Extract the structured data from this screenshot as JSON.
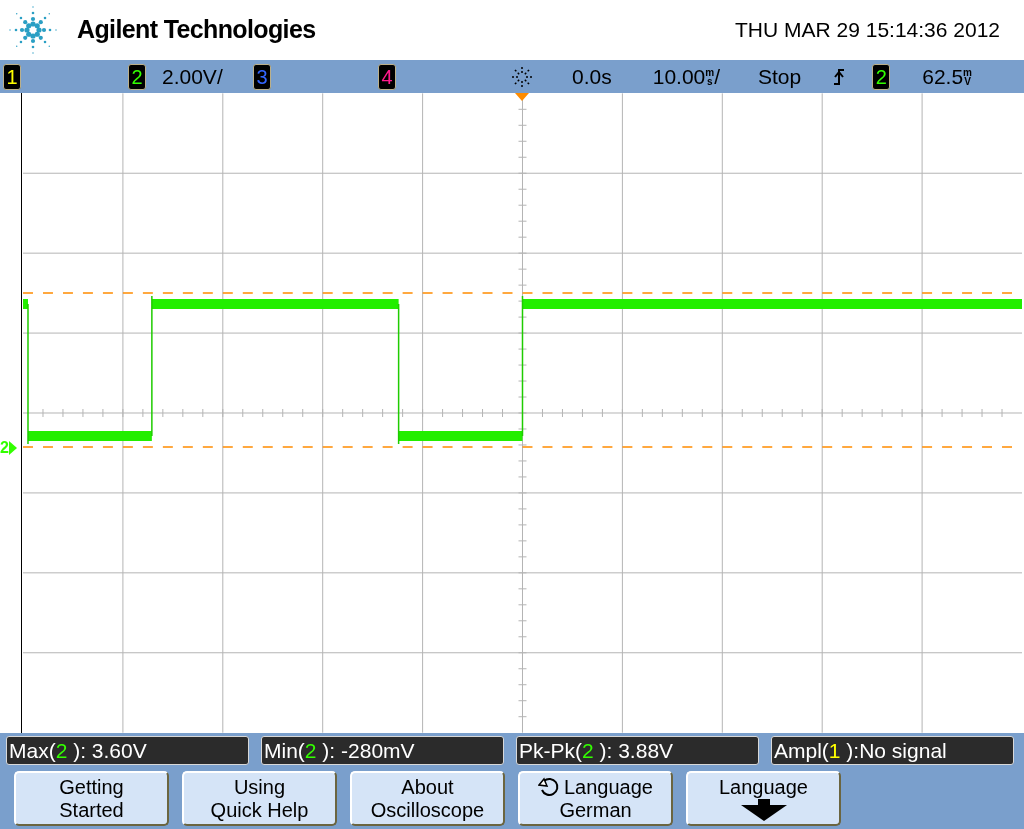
{
  "header": {
    "brand": "Agilent Technologies",
    "datetime": "THU MAR 29 15:14:36 2012"
  },
  "status_bar": {
    "channels": [
      {
        "label": "1",
        "color": "#ffff00"
      },
      {
        "label": "2",
        "color": "#33ff00",
        "scale": "2.00V/"
      },
      {
        "label": "3",
        "color": "#3366ff"
      },
      {
        "label": "4",
        "color": "#ff1a8c"
      }
    ],
    "delay": "0.0s",
    "timebase": {
      "value": "10.00",
      "unit_top": "m",
      "unit_bottom": "s",
      "suffix": "/"
    },
    "run_state": "Stop",
    "trigger_channel": {
      "label": "2",
      "color": "#33ff00"
    },
    "trigger_level": {
      "value": "62.5",
      "unit_top": "m",
      "unit_bottom": "V"
    }
  },
  "graticule": {
    "ground_marker": {
      "label": "2",
      "color": "#33ff00"
    }
  },
  "measurements": [
    {
      "prefix": "Max(",
      "channel": "2",
      "color": "#33ff00",
      "suffix": " ): 3.60V"
    },
    {
      "prefix": "Min(",
      "channel": "2",
      "color": "#33ff00",
      "suffix": " ): -280mV"
    },
    {
      "prefix": "Pk-Pk(",
      "channel": "2",
      "color": "#33ff00",
      "suffix": " ): 3.88V"
    },
    {
      "prefix": "Ampl(",
      "channel": "1",
      "color": "#ffff00",
      "suffix": " ):No signal"
    }
  ],
  "softkeys": [
    {
      "kind": "text",
      "lines": [
        "Getting",
        "Started"
      ]
    },
    {
      "kind": "text",
      "lines": [
        "Using",
        "Quick Help"
      ]
    },
    {
      "kind": "text",
      "lines": [
        "About",
        "Oscilloscope"
      ]
    },
    {
      "kind": "cycle",
      "lines": [
        "Language",
        "German"
      ]
    },
    {
      "kind": "arrow",
      "lines": [
        "Language"
      ]
    }
  ]
}
